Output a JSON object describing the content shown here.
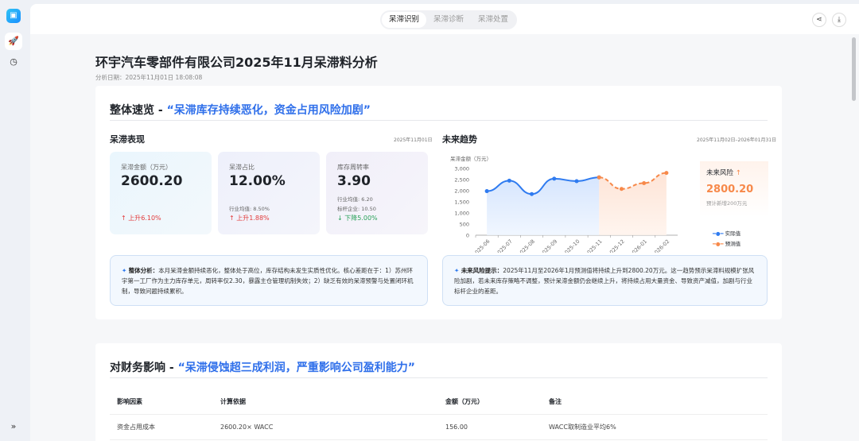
{
  "app": {
    "logo_icon": "image-sparkle-icon",
    "side_icons": [
      "rocket-icon",
      "clock-icon",
      "expand-icon"
    ]
  },
  "tabs": [
    {
      "label": "呆滞识别",
      "active": true
    },
    {
      "label": "呆滞诊断",
      "active": false
    },
    {
      "label": "呆滞处置",
      "active": false
    }
  ],
  "toolbar": {
    "share_icon": "share-icon",
    "download_icon": "download-icon"
  },
  "report": {
    "title": "环宇汽车零部件有限公司2025年11月呆滞料分析",
    "date": "分析日期：2025年11月01日 18:08:08"
  },
  "overview": {
    "title": "整体速览 - ",
    "quote": "“呆滞库存持续恶化，资金占用风险加剧”",
    "perf": {
      "title": "呆滞表现",
      "date": "2025年11月01日",
      "kpis": [
        {
          "label": "呆滞金额（万元）",
          "value": "2600.20",
          "change": "上升6.10%",
          "direction": "up"
        },
        {
          "label": "呆滞占比",
          "value": "12.00%",
          "industry": "行业均值: 8.50%",
          "change": "上升1.88%",
          "direction": "up"
        },
        {
          "label": "库存周转率",
          "value": "3.90",
          "industry": "行业均值: 6.20",
          "benchmark": "标杆企业: 10.50",
          "change": "下降5.00%",
          "direction": "down"
        }
      ],
      "analysis_label": "整体分析：",
      "analysis": "本月呆滞金额持续恶化，整体处于高位，库存结构未发生实质性优化。核心差距在于：1）苏州环宇第一工厂作为主力库存单元，周转率仅2.30，暴露主仓管理机制失效；2）缺乏有效的呆滞预警与处置闭环机制，导致问题持续累积。"
    },
    "trend": {
      "title": "未来趋势",
      "date": "2025年11月02日–2026年01月31日",
      "risk_label": "未来风险",
      "risk_value": "2800.20",
      "risk_note": "预计新增200万元",
      "hint_label": "未来风险提示：",
      "hint": "2025年11月至2026年1月预测值将持续上升到2800.20万元。这一趋势预示呆滞料规模扩张风险加剧，若未来库存策略不调整，预计呆滞金额仍会继续上升，将持续占用大量资金、导致资产减值，加剧与行业标杆企业的差距。"
    }
  },
  "chart_data": {
    "type": "line",
    "ylabel": "呆滞金额（万元）",
    "ylim": [
      0,
      3000
    ],
    "yticks": [
      "0",
      "500",
      "1,000",
      "1,500",
      "2,000",
      "2,500",
      "3,000"
    ],
    "categories": [
      "2025-06",
      "2025-07",
      "2025-08",
      "2025-09",
      "2025-10",
      "2025-11",
      "2025-12",
      "2026-01",
      "2026-02"
    ],
    "series": [
      {
        "name": "实际值",
        "color": "#2f7bf0",
        "values": [
          1980,
          2450,
          1850,
          2540,
          2430,
          2600,
          null,
          null,
          null
        ]
      },
      {
        "name": "预测值",
        "color": "#f7894a",
        "values": [
          null,
          null,
          null,
          null,
          null,
          2600,
          2080,
          2340,
          2800
        ]
      }
    ],
    "legend": "right"
  },
  "finance": {
    "title": "对财务影响 - ",
    "quote": "“呆滞侵蚀超三成利润，严重影响公司盈利能力”",
    "headers": [
      "影响因素",
      "计算依据",
      "金额（万元）",
      "备注"
    ],
    "rows": [
      [
        "资金占用成本",
        "2600.20× WACC",
        "156.00",
        "WACC取制造业平均6%"
      ]
    ]
  }
}
